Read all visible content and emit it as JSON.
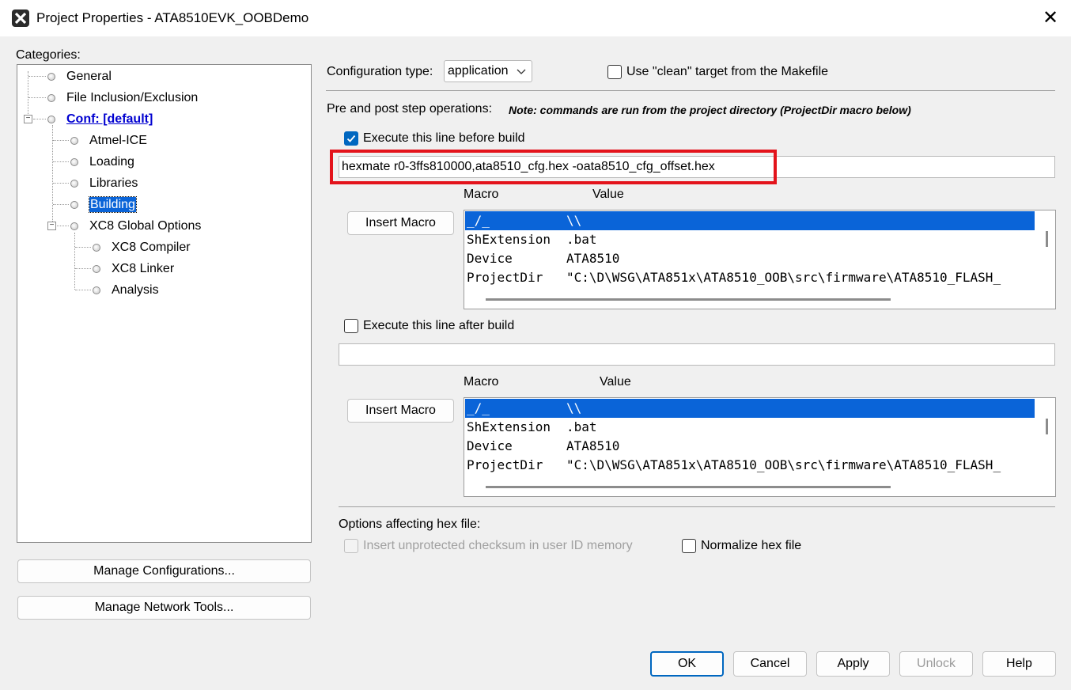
{
  "window": {
    "title": "Project Properties - ATA8510EVK_OOBDemo",
    "close_glyph": "✕",
    "app_icon": "mplab-x-icon"
  },
  "categories": {
    "label": "Categories:",
    "items": [
      {
        "label": "General"
      },
      {
        "label": "File Inclusion/Exclusion"
      },
      {
        "label": "Conf: [default]"
      },
      {
        "label": "Atmel-ICE"
      },
      {
        "label": "Loading"
      },
      {
        "label": "Libraries"
      },
      {
        "label": "Building"
      },
      {
        "label": "XC8 Global Options"
      },
      {
        "label": "XC8 Compiler"
      },
      {
        "label": "XC8 Linker"
      },
      {
        "label": "Analysis"
      }
    ],
    "selected": "Building",
    "toggle_glyph": "−",
    "manage_configurations": "Manage Configurations...",
    "manage_network_tools": "Manage Network Tools..."
  },
  "config": {
    "type_label": "Configuration type:",
    "type_value": "application",
    "clean_label": "Use \"clean\" target from the Makefile",
    "clean_checked": false
  },
  "prepost": {
    "label": "Pre and post step operations:",
    "note": "Note: commands are run from the project directory (ProjectDir macro below)"
  },
  "before": {
    "checkbox_label": "Execute this line before build",
    "checked": true,
    "command": "hexmate r0-3ffs810000,ata8510_cfg.hex -oata8510_cfg_offset.hex",
    "insert_macro": "Insert Macro",
    "macro_header": "Macro",
    "value_header": "Value",
    "rows": [
      {
        "macro": "_/_",
        "value": "\\\\"
      },
      {
        "macro": "ShExtension",
        "value": ".bat"
      },
      {
        "macro": "Device",
        "value": "ATA8510"
      },
      {
        "macro": "ProjectDir",
        "value": "\"C:\\D\\WSG\\ATA851x\\ATA8510_OOB\\src\\firmware\\ATA8510_FLASH_"
      }
    ]
  },
  "after": {
    "checkbox_label": "Execute this line after build",
    "checked": false,
    "command": "",
    "insert_macro": "Insert Macro",
    "macro_header": "Macro",
    "value_header": "Value",
    "rows": [
      {
        "macro": "_/_",
        "value": "\\\\"
      },
      {
        "macro": "ShExtension",
        "value": ".bat"
      },
      {
        "macro": "Device",
        "value": "ATA8510"
      },
      {
        "macro": "ProjectDir",
        "value": "\"C:\\D\\WSG\\ATA851x\\ATA8510_OOB\\src\\firmware\\ATA8510_FLASH_"
      }
    ]
  },
  "hex": {
    "label": "Options affecting hex file:",
    "checksum_label": "Insert unprotected checksum in user ID memory",
    "checksum_enabled": false,
    "normalize_label": "Normalize hex file",
    "normalize_checked": false
  },
  "buttons": {
    "ok": "OK",
    "cancel": "Cancel",
    "apply": "Apply",
    "unlock": "Unlock",
    "help": "Help"
  },
  "colors": {
    "selection": "#0a64d8",
    "highlight_box": "#e3131b",
    "primary_border": "#0067c0",
    "link": "#0000d0"
  }
}
